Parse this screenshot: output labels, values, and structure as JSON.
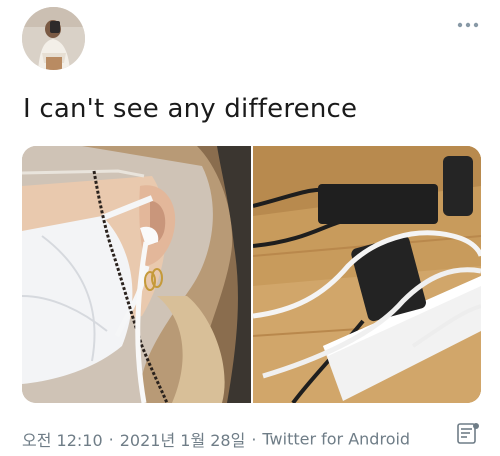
{
  "tweet": {
    "text": "I can't see any difference",
    "time": "오전 12:10",
    "date": "2021년 1월 28일",
    "separator": "·",
    "source": "Twitter for Android"
  },
  "icons": {
    "more": "more-horizontal-icon",
    "analytics": "tweet-analytics-icon"
  },
  "colors": {
    "text": "#14171a",
    "meta": "#6f7d87"
  }
}
